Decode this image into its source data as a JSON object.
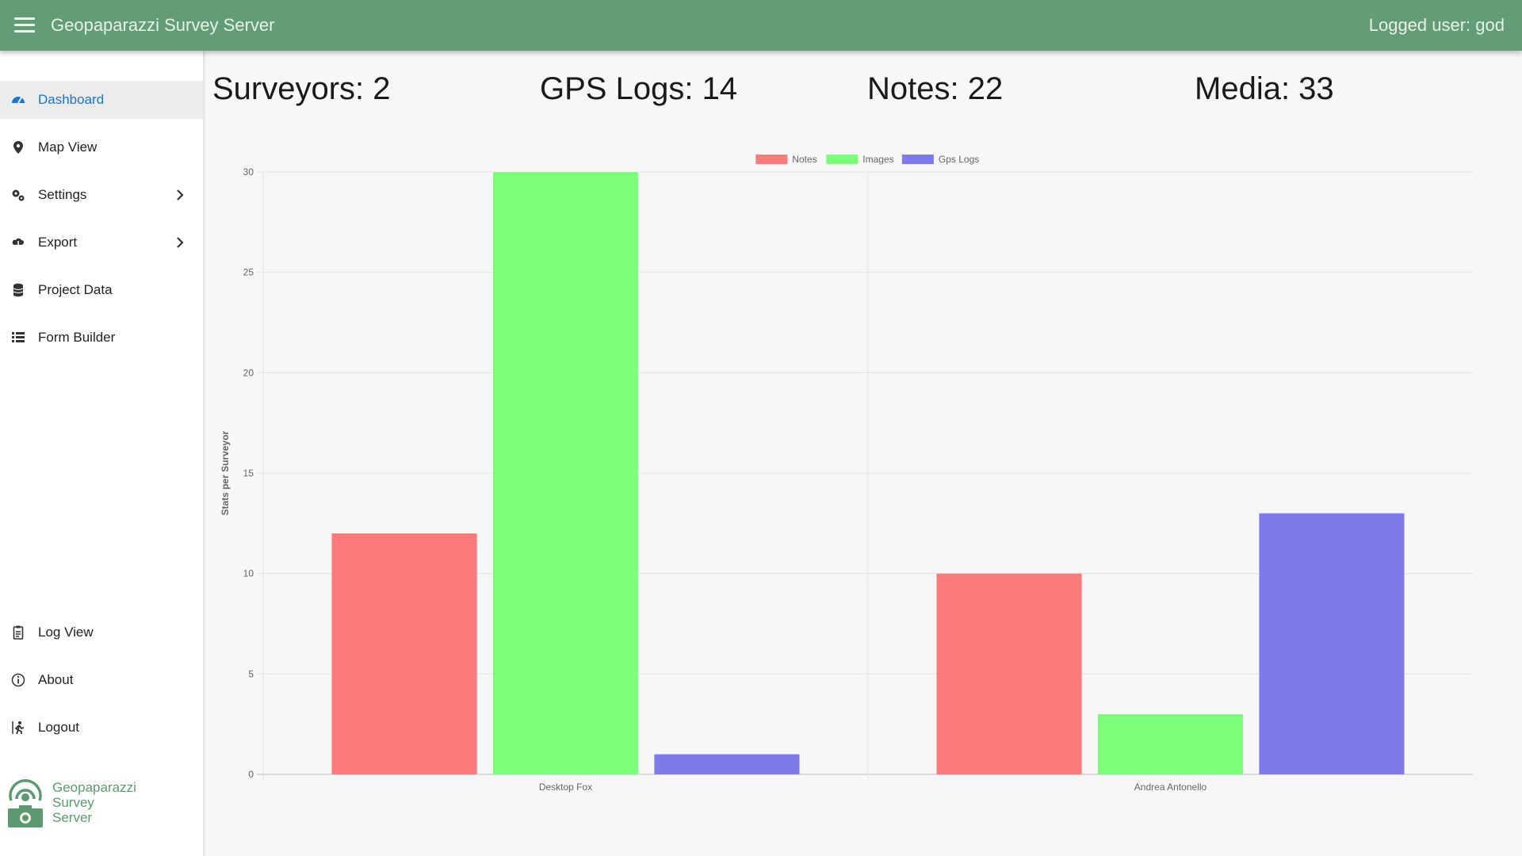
{
  "header": {
    "app_title": "Geopaparazzi Survey Server",
    "logged_user": "Logged user: god"
  },
  "sidebar": {
    "items": [
      {
        "label": "Dashboard",
        "icon": "dashboard-icon",
        "active": true
      },
      {
        "label": "Map View",
        "icon": "map-pin-icon"
      },
      {
        "label": "Settings",
        "icon": "gears-icon",
        "has_submenu": true
      },
      {
        "label": "Export",
        "icon": "export-icon",
        "has_submenu": true
      },
      {
        "label": "Project Data",
        "icon": "database-icon"
      },
      {
        "label": "Form Builder",
        "icon": "list-icon"
      },
      {
        "label": "Log View",
        "icon": "log-icon"
      },
      {
        "label": "About",
        "icon": "info-icon"
      },
      {
        "label": "Logout",
        "icon": "logout-icon"
      }
    ],
    "brand": {
      "line1": "Geopaparazzi",
      "line2": "Survey",
      "line3": "Server"
    }
  },
  "stats": [
    {
      "label": "Surveyors: ",
      "value": "2"
    },
    {
      "label": "GPS Logs: ",
      "value": "14"
    },
    {
      "label": "Notes: ",
      "value": "22"
    },
    {
      "label": "Media: ",
      "value": "33"
    }
  ],
  "colors": {
    "header": "#629d77",
    "active": "#1976d2",
    "notes": "#ff7a7a",
    "images": "#7dff7a",
    "gpslogs": "#7d7aeb"
  },
  "chart_data": {
    "type": "bar",
    "categories": [
      "Desktop Fox",
      "Andrea Antonello"
    ],
    "series": [
      {
        "name": "Notes",
        "values": [
          12,
          10
        ],
        "color": "#ff7a7a"
      },
      {
        "name": "Images",
        "values": [
          30,
          3
        ],
        "color": "#7dff7a"
      },
      {
        "name": "Gps Logs",
        "values": [
          1,
          13
        ],
        "color": "#7d7aeb"
      }
    ],
    "ylabel": "Stats per Surveyor",
    "xlabel": "",
    "ylim": [
      0,
      30
    ],
    "yticks": [
      0,
      5,
      10,
      15,
      20,
      25,
      30
    ],
    "legend": "top-center",
    "grid": true
  }
}
